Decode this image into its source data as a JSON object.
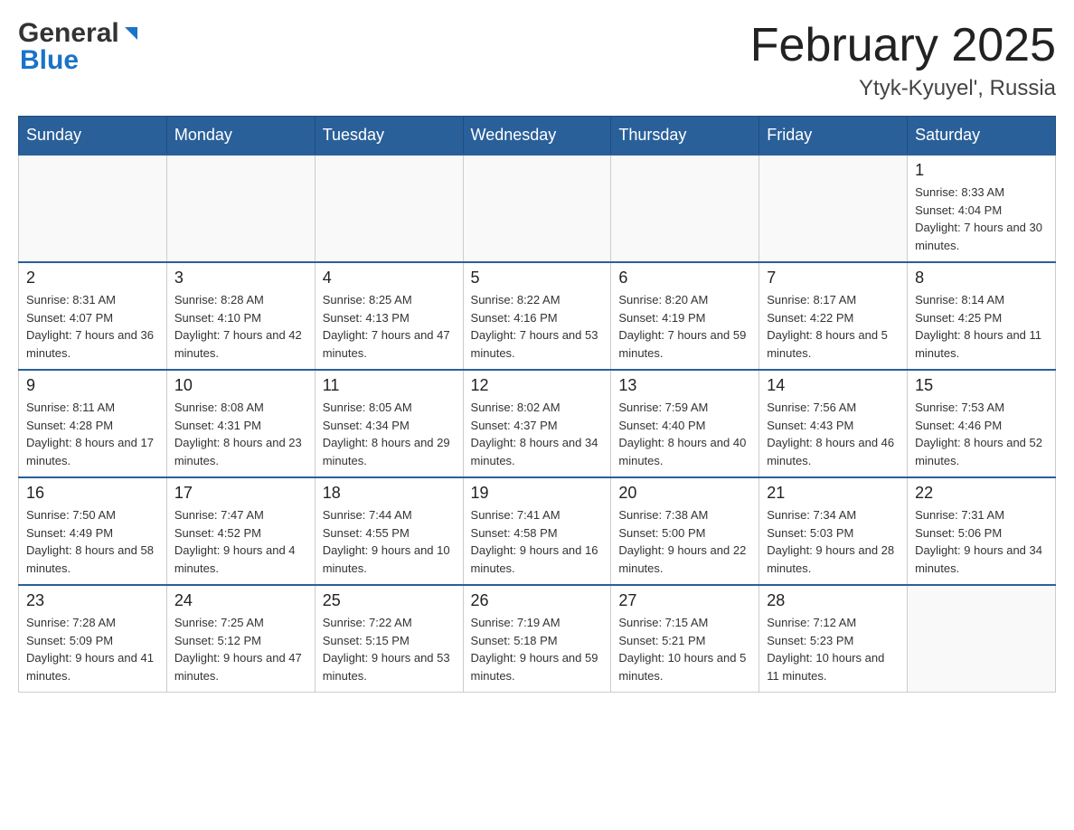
{
  "header": {
    "logo_main": "General",
    "logo_accent": "Blue",
    "title": "February 2025",
    "subtitle": "Ytyk-Kyuyel', Russia"
  },
  "days_of_week": [
    "Sunday",
    "Monday",
    "Tuesday",
    "Wednesday",
    "Thursday",
    "Friday",
    "Saturday"
  ],
  "weeks": [
    {
      "days": [
        {
          "date": "",
          "info": ""
        },
        {
          "date": "",
          "info": ""
        },
        {
          "date": "",
          "info": ""
        },
        {
          "date": "",
          "info": ""
        },
        {
          "date": "",
          "info": ""
        },
        {
          "date": "",
          "info": ""
        },
        {
          "date": "1",
          "info": "Sunrise: 8:33 AM\nSunset: 4:04 PM\nDaylight: 7 hours and 30 minutes."
        }
      ]
    },
    {
      "days": [
        {
          "date": "2",
          "info": "Sunrise: 8:31 AM\nSunset: 4:07 PM\nDaylight: 7 hours and 36 minutes."
        },
        {
          "date": "3",
          "info": "Sunrise: 8:28 AM\nSunset: 4:10 PM\nDaylight: 7 hours and 42 minutes."
        },
        {
          "date": "4",
          "info": "Sunrise: 8:25 AM\nSunset: 4:13 PM\nDaylight: 7 hours and 47 minutes."
        },
        {
          "date": "5",
          "info": "Sunrise: 8:22 AM\nSunset: 4:16 PM\nDaylight: 7 hours and 53 minutes."
        },
        {
          "date": "6",
          "info": "Sunrise: 8:20 AM\nSunset: 4:19 PM\nDaylight: 7 hours and 59 minutes."
        },
        {
          "date": "7",
          "info": "Sunrise: 8:17 AM\nSunset: 4:22 PM\nDaylight: 8 hours and 5 minutes."
        },
        {
          "date": "8",
          "info": "Sunrise: 8:14 AM\nSunset: 4:25 PM\nDaylight: 8 hours and 11 minutes."
        }
      ]
    },
    {
      "days": [
        {
          "date": "9",
          "info": "Sunrise: 8:11 AM\nSunset: 4:28 PM\nDaylight: 8 hours and 17 minutes."
        },
        {
          "date": "10",
          "info": "Sunrise: 8:08 AM\nSunset: 4:31 PM\nDaylight: 8 hours and 23 minutes."
        },
        {
          "date": "11",
          "info": "Sunrise: 8:05 AM\nSunset: 4:34 PM\nDaylight: 8 hours and 29 minutes."
        },
        {
          "date": "12",
          "info": "Sunrise: 8:02 AM\nSunset: 4:37 PM\nDaylight: 8 hours and 34 minutes."
        },
        {
          "date": "13",
          "info": "Sunrise: 7:59 AM\nSunset: 4:40 PM\nDaylight: 8 hours and 40 minutes."
        },
        {
          "date": "14",
          "info": "Sunrise: 7:56 AM\nSunset: 4:43 PM\nDaylight: 8 hours and 46 minutes."
        },
        {
          "date": "15",
          "info": "Sunrise: 7:53 AM\nSunset: 4:46 PM\nDaylight: 8 hours and 52 minutes."
        }
      ]
    },
    {
      "days": [
        {
          "date": "16",
          "info": "Sunrise: 7:50 AM\nSunset: 4:49 PM\nDaylight: 8 hours and 58 minutes."
        },
        {
          "date": "17",
          "info": "Sunrise: 7:47 AM\nSunset: 4:52 PM\nDaylight: 9 hours and 4 minutes."
        },
        {
          "date": "18",
          "info": "Sunrise: 7:44 AM\nSunset: 4:55 PM\nDaylight: 9 hours and 10 minutes."
        },
        {
          "date": "19",
          "info": "Sunrise: 7:41 AM\nSunset: 4:58 PM\nDaylight: 9 hours and 16 minutes."
        },
        {
          "date": "20",
          "info": "Sunrise: 7:38 AM\nSunset: 5:00 PM\nDaylight: 9 hours and 22 minutes."
        },
        {
          "date": "21",
          "info": "Sunrise: 7:34 AM\nSunset: 5:03 PM\nDaylight: 9 hours and 28 minutes."
        },
        {
          "date": "22",
          "info": "Sunrise: 7:31 AM\nSunset: 5:06 PM\nDaylight: 9 hours and 34 minutes."
        }
      ]
    },
    {
      "days": [
        {
          "date": "23",
          "info": "Sunrise: 7:28 AM\nSunset: 5:09 PM\nDaylight: 9 hours and 41 minutes."
        },
        {
          "date": "24",
          "info": "Sunrise: 7:25 AM\nSunset: 5:12 PM\nDaylight: 9 hours and 47 minutes."
        },
        {
          "date": "25",
          "info": "Sunrise: 7:22 AM\nSunset: 5:15 PM\nDaylight: 9 hours and 53 minutes."
        },
        {
          "date": "26",
          "info": "Sunrise: 7:19 AM\nSunset: 5:18 PM\nDaylight: 9 hours and 59 minutes."
        },
        {
          "date": "27",
          "info": "Sunrise: 7:15 AM\nSunset: 5:21 PM\nDaylight: 10 hours and 5 minutes."
        },
        {
          "date": "28",
          "info": "Sunrise: 7:12 AM\nSunset: 5:23 PM\nDaylight: 10 hours and 11 minutes."
        },
        {
          "date": "",
          "info": ""
        }
      ]
    }
  ]
}
